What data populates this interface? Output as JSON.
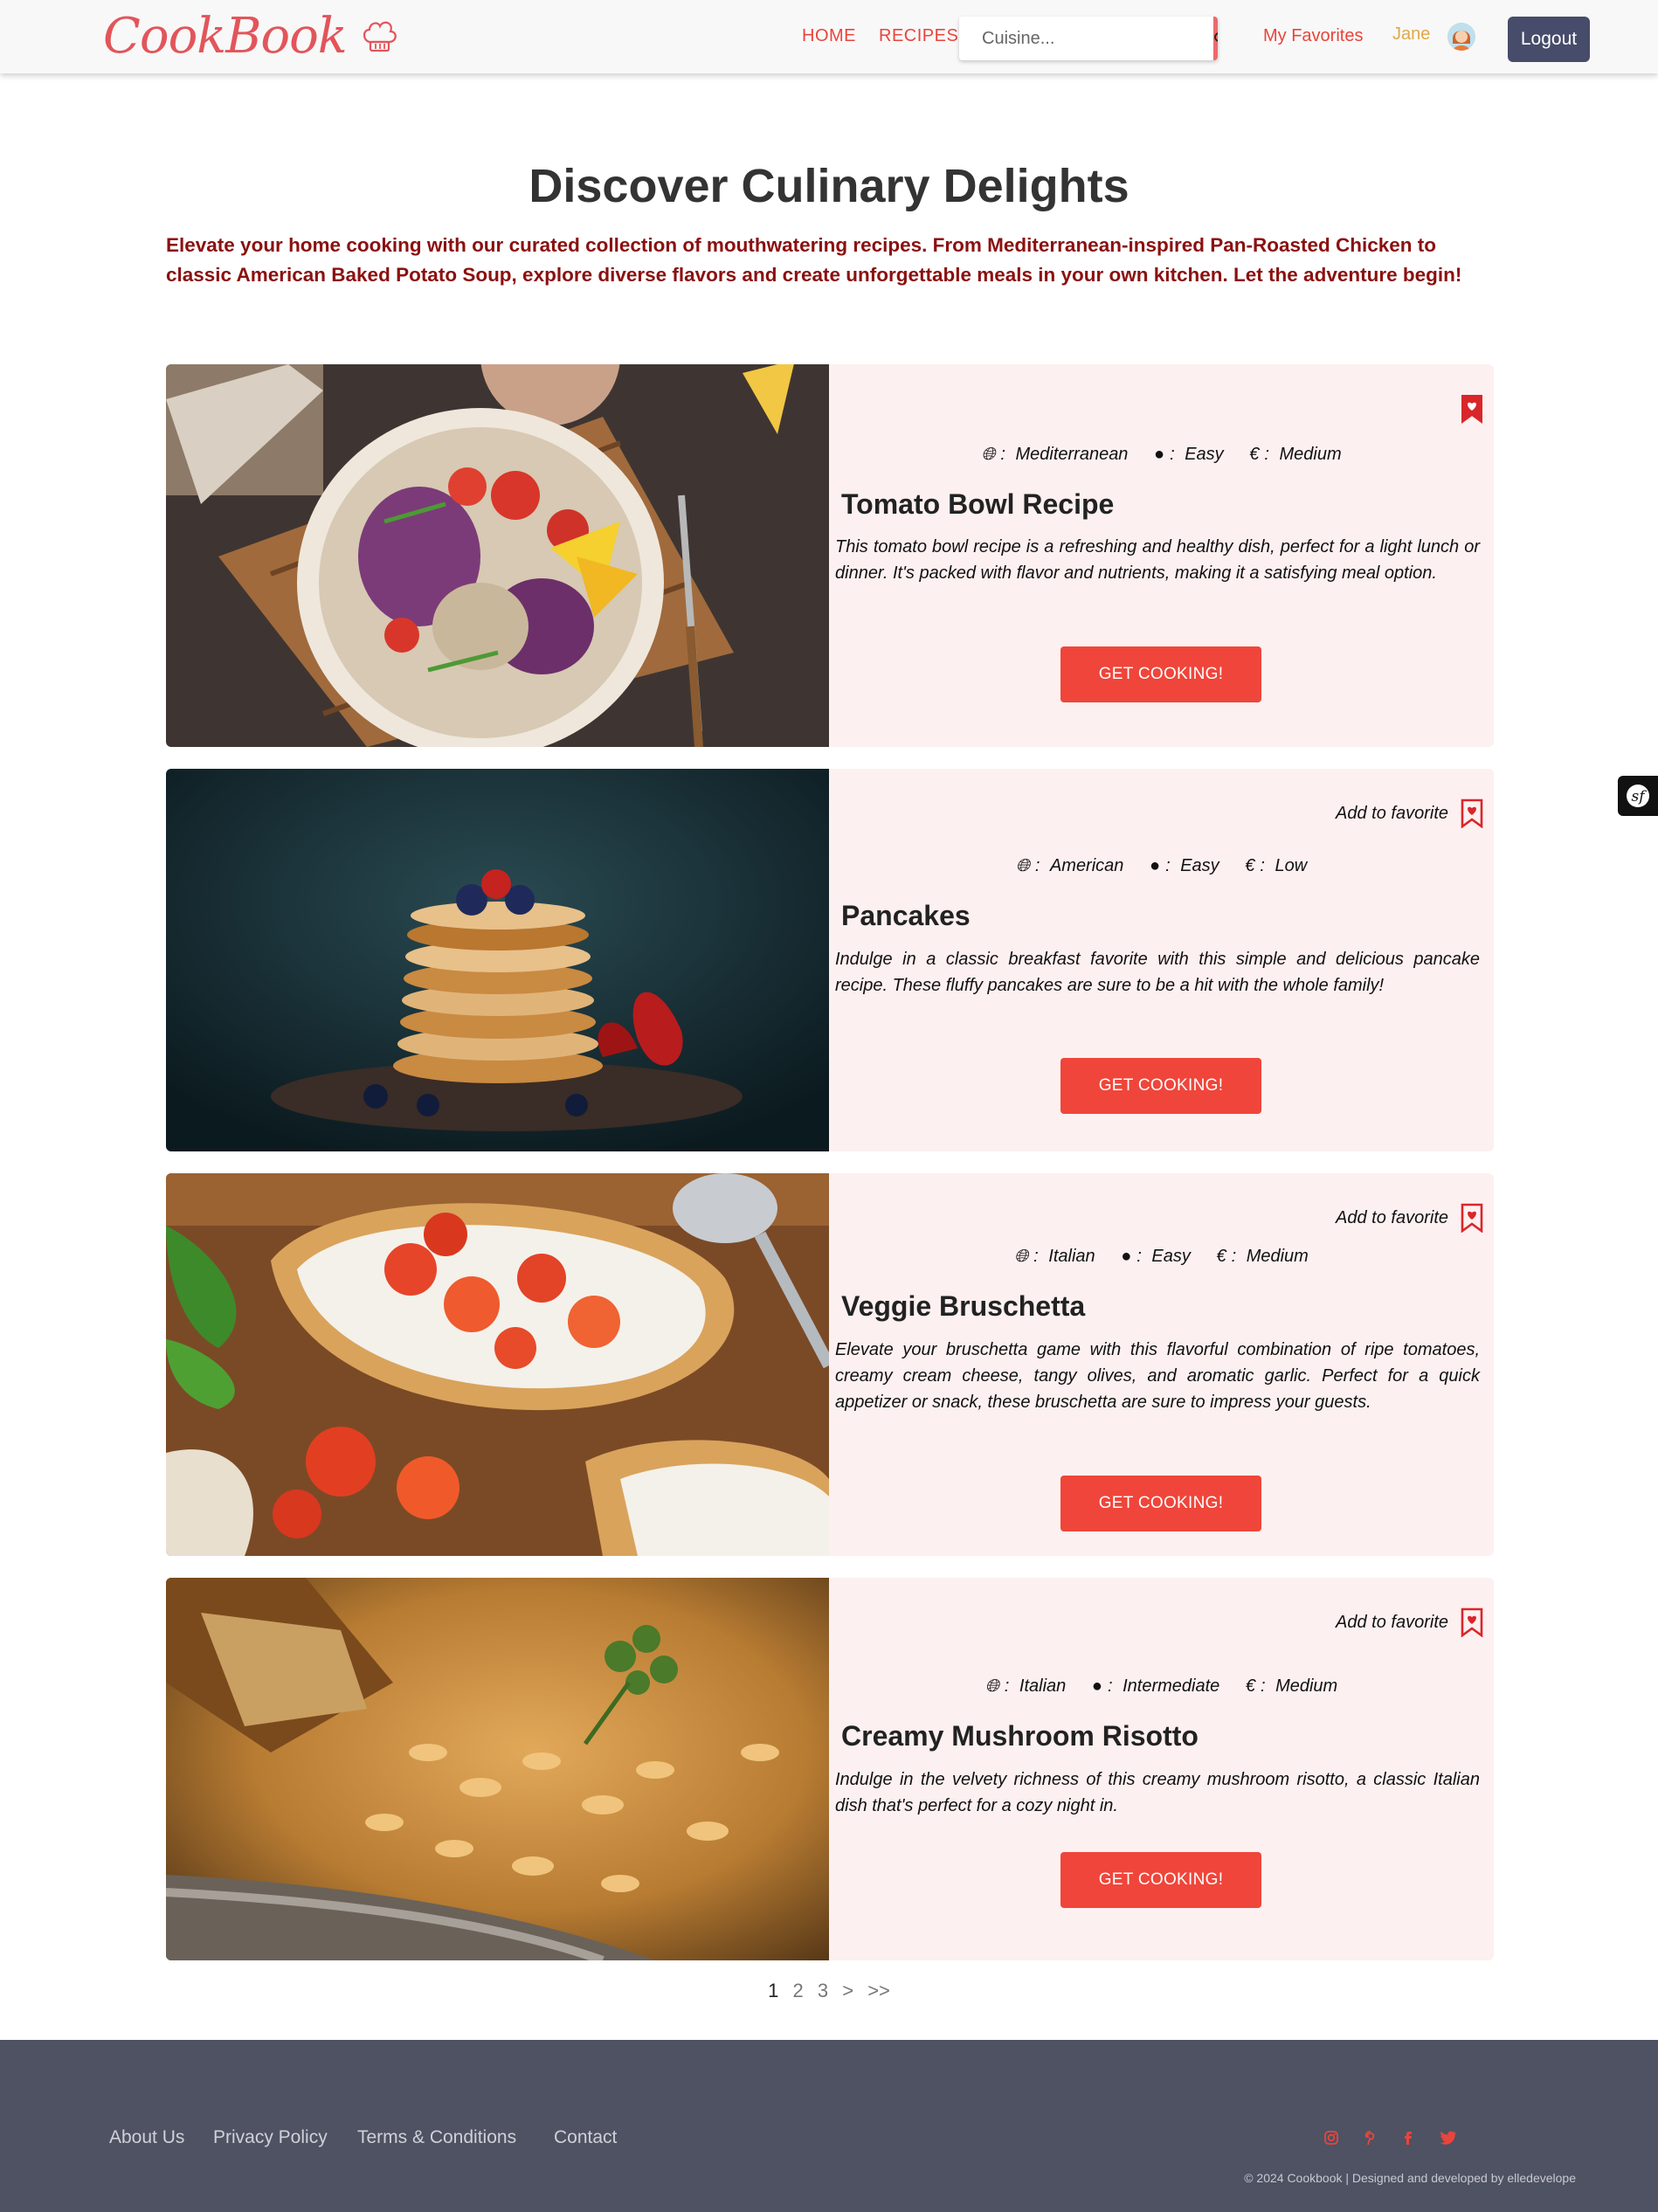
{
  "nav": {
    "logo_text": "CookBook",
    "home": "HOME",
    "recipes": "RECIPES",
    "search_placeholder": "Cuisine...",
    "favorites": "My Favorites",
    "user": "Jane",
    "logout": "Logout"
  },
  "hero": {
    "title": "Discover Culinary Delights",
    "description": "Elevate your home cooking with our curated collection of mouthwatering recipes. From Mediterranean-inspired Pan-Roasted Chicken to classic American Baked Potato Soup, explore diverse flavors and create unforgettable meals in your own kitchen. Let the adventure begin!"
  },
  "recipes": [
    {
      "title": "Tomato Bowl Recipe",
      "cuisine": "Mediterranean",
      "difficulty": "Easy",
      "cost": "Medium",
      "favorite_label": "",
      "is_favorite": true,
      "description": "This tomato bowl recipe is a refreshing and healthy dish, perfect for a light lunch or dinner. It's packed with flavor and nutrients, making it a satisfying meal option.",
      "button": "GET COOKING!",
      "image": "salad-bowl-image"
    },
    {
      "title": "Pancakes",
      "cuisine": "American",
      "difficulty": "Easy",
      "cost": "Low",
      "favorite_label": "Add to favorite",
      "is_favorite": false,
      "description": "Indulge in a classic breakfast favorite with this simple and delicious pancake recipe. These fluffy pancakes are sure to be a hit with the whole family!",
      "button": "GET COOKING!",
      "image": "pancakes-image"
    },
    {
      "title": "Veggie Bruschetta",
      "cuisine": "Italian",
      "difficulty": "Easy",
      "cost": "Medium",
      "favorite_label": "Add to favorite",
      "is_favorite": false,
      "description": "Elevate your bruschetta game with this flavorful combination of ripe tomatoes, creamy cream cheese, tangy olives, and aromatic garlic. Perfect for a quick appetizer or snack, these bruschetta are sure to impress your guests.",
      "button": "GET COOKING!",
      "image": "bruschetta-image"
    },
    {
      "title": "Creamy Mushroom Risotto",
      "cuisine": "Italian",
      "difficulty": "Intermediate",
      "cost": "Medium",
      "favorite_label": "Add to favorite",
      "is_favorite": false,
      "description": "Indulge in the velvety richness of this creamy mushroom risotto, a classic Italian dish that's perfect for a cozy night in.",
      "button": "GET COOKING!",
      "image": "risotto-image"
    }
  ],
  "meta_separator": ": ",
  "pagination": {
    "pages": [
      "1",
      "2",
      "3"
    ],
    "current": "1",
    "next": ">",
    "last": ">>"
  },
  "footer": {
    "links": [
      "About Us",
      "Privacy Policy",
      "Terms & Conditions",
      "Contact"
    ],
    "social_icons": [
      "instagram-icon",
      "pinterest-icon",
      "facebook-icon",
      "twitter-icon"
    ],
    "copyright": "© 2024 Cookbook | Designed and developed by elledevelope"
  },
  "colors": {
    "accent": "#f0453a",
    "nav_link": "#e8453c",
    "card_bg": "#fdf0f0",
    "hero_desc": "#8b1010",
    "footer_bg": "#4e5263",
    "logout_bg": "#474c6a"
  }
}
